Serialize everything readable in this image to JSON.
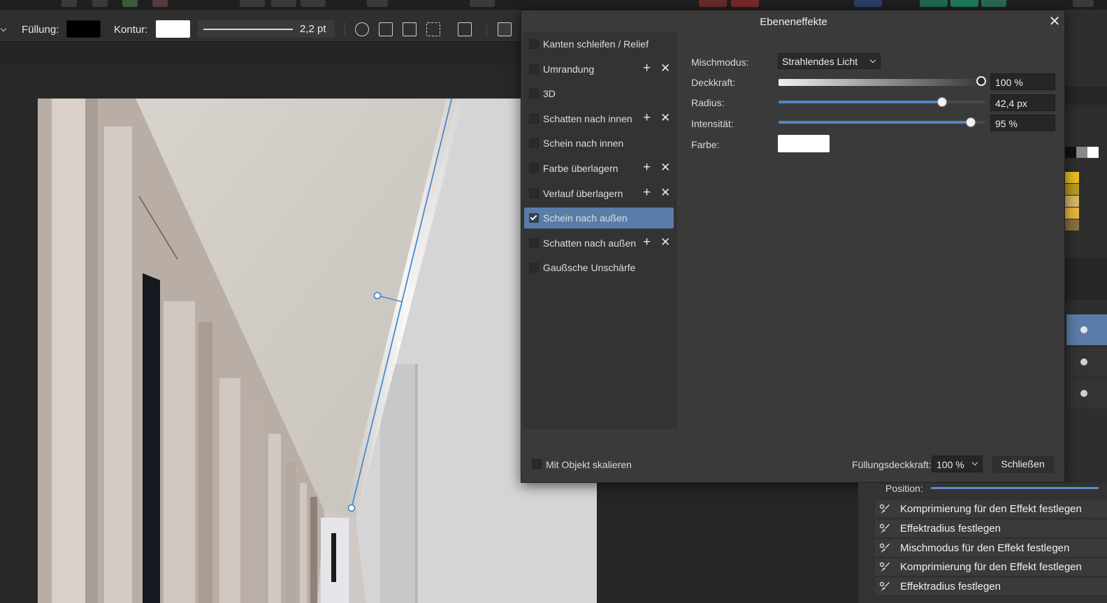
{
  "toolbar": {
    "fill_label": "Füllung:",
    "stroke_label": "Kontur:",
    "stroke_width": "2,2 pt",
    "fill_color": "#000000",
    "stroke_color": "#ffffff"
  },
  "dialog": {
    "title": "Ebeneneffekte",
    "close_icon": "close-icon",
    "effects": [
      {
        "label": "Kanten schleifen / Relief",
        "checked": false,
        "has_actions": false
      },
      {
        "label": "Umrandung",
        "checked": false,
        "has_actions": true
      },
      {
        "label": "3D",
        "checked": false,
        "has_actions": false
      },
      {
        "label": "Schatten nach innen",
        "checked": false,
        "has_actions": true
      },
      {
        "label": "Schein nach innen",
        "checked": false,
        "has_actions": false
      },
      {
        "label": "Farbe überlagern",
        "checked": false,
        "has_actions": true
      },
      {
        "label": "Verlauf überlagern",
        "checked": false,
        "has_actions": true
      },
      {
        "label": "Schein nach außen",
        "checked": true,
        "has_actions": false
      },
      {
        "label": "Schatten nach außen",
        "checked": false,
        "has_actions": true
      },
      {
        "label": "Gaußsche Unschärfe",
        "checked": false,
        "has_actions": false
      }
    ],
    "plus_symbol": "+",
    "x_symbol": "✕",
    "props": {
      "blend_label": "Mischmodus:",
      "blend_value": "Strahlendes Licht",
      "opacity_label": "Deckkraft:",
      "opacity_value": "100 %",
      "opacity_fraction": 1.0,
      "radius_label": "Radius:",
      "radius_value": "42,4 px",
      "radius_fraction": 0.79,
      "intensity_label": "Intensität:",
      "intensity_value": "95 %",
      "intensity_fraction": 0.93,
      "color_label": "Farbe:",
      "color_value": "#ffffff"
    },
    "footer": {
      "scale_label": "Mit Objekt skalieren",
      "fill_opacity_label": "Füllungsdeckkraft:",
      "fill_opacity_value": "100 %",
      "close_label": "Schließen"
    }
  },
  "history": {
    "position_label": "Position:",
    "items": [
      "Komprimierung für den Effekt festlegen",
      "Effektradius festlegen",
      "Mischmodus für den Effekt festlegen",
      "Komprimierung für den Effekt festlegen",
      "Effektradius festlegen"
    ]
  },
  "colors": {
    "accent": "#5a7ca8",
    "slider_blue": "#4f86c6"
  }
}
